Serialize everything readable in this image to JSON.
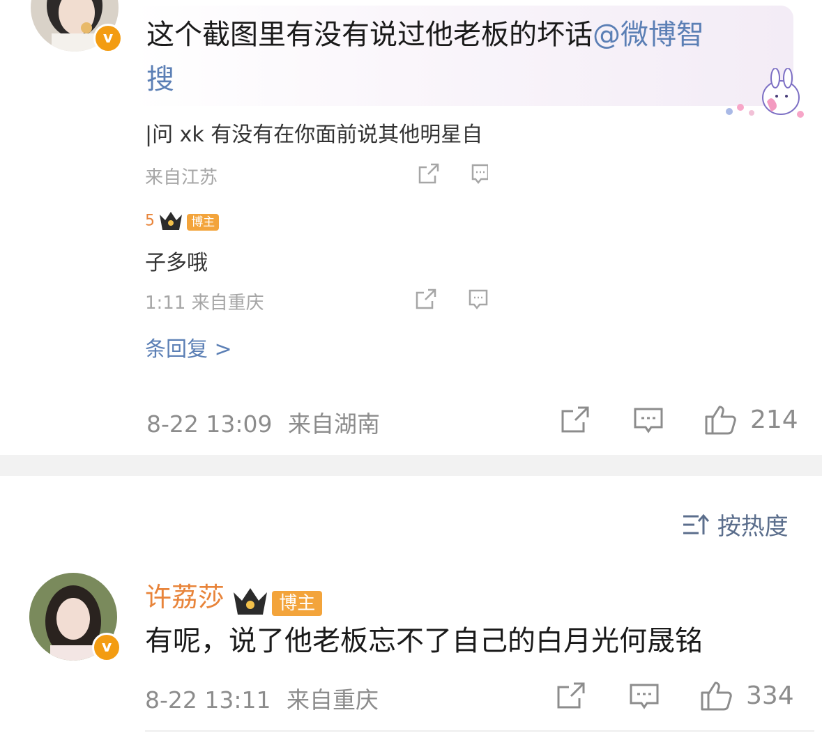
{
  "comment1": {
    "text": "这个截图里有没有说过他老板的坏话",
    "mention": "@微博智",
    "text_wrap": "搜",
    "embedded_screenshot": {
      "line1": "|问 xk 有没有在你面前说其他明星自",
      "meta1": "来自江苏",
      "badge": "博主",
      "name_fragment": "5",
      "reply_text": "子多哦",
      "meta2": "1:11 来自重庆",
      "more_replies": "条回复 >"
    },
    "date": "8-22 13:09",
    "location": "来自湖南",
    "likes": "214"
  },
  "sort": {
    "label": "按热度"
  },
  "comment2": {
    "username": "许荔莎",
    "badge": "博主",
    "text": "有呢，说了他老板忘不了自己的白月光何晟铭",
    "date": "8-22 13:11",
    "location": "来自重庆",
    "likes": "334"
  },
  "colors": {
    "accent": "#5b7fb5",
    "name": "#e8843a",
    "badge": "#f3a43b",
    "verified": "#f39c12"
  }
}
